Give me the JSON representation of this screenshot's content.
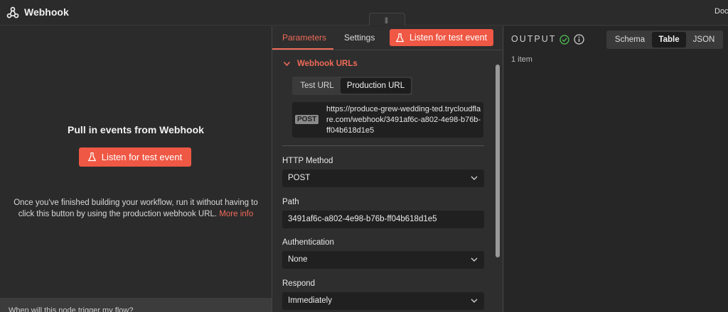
{
  "header": {
    "title": "Webhook",
    "docs_label": "Doc"
  },
  "left_panel": {
    "heading": "Pull in events from Webhook",
    "listen_button": "Listen for test event",
    "description": "Once you've finished building your workflow, run it without having to click this button by using the production webhook URL.",
    "more_info_link": "More info",
    "footer_text": "When will this node trigger my flow?"
  },
  "params": {
    "tabs": [
      "Parameters",
      "Settings"
    ],
    "active_tab": "Parameters",
    "listen_button": "Listen for test event",
    "section_title": "Webhook URLs",
    "url_toggle": [
      "Test URL",
      "Production URL"
    ],
    "url_toggle_selected": "Production URL",
    "method_badge": "POST",
    "url": "https://produce-grew-wedding-ted.trycloudflare.com/webhook/3491af6c-a802-4e98-b76b-ff04b618d1e5",
    "http_method_label": "HTTP Method",
    "http_method_value": "POST",
    "path_label": "Path",
    "path_value": "3491af6c-a802-4e98-b76b-ff04b618d1e5",
    "auth_label": "Authentication",
    "auth_value": "None",
    "respond_label": "Respond",
    "respond_value": "Immediately"
  },
  "output": {
    "title": "OUTPUT",
    "view_modes": [
      "Schema",
      "Table",
      "JSON"
    ],
    "view_selected": "Table",
    "item_count": "1 item"
  },
  "colors": {
    "accent": "#ef5844",
    "success": "#4caf50"
  }
}
